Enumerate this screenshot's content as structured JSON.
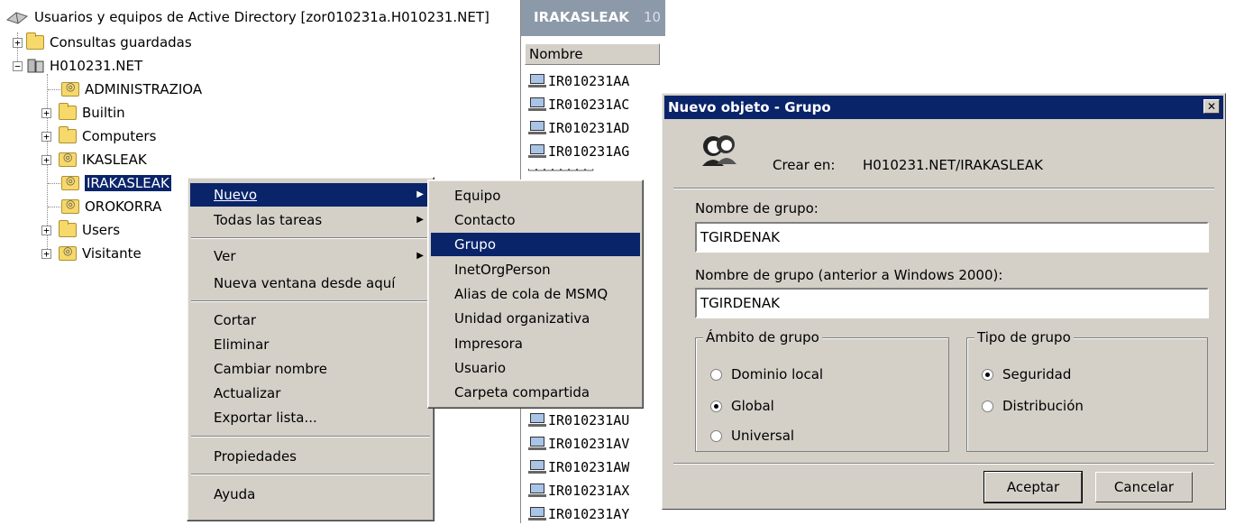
{
  "tree": {
    "root": "Usuarios y equipos de Active Directory [zor010231a.H010231.NET]",
    "items": [
      {
        "label": "Consultas guardadas",
        "type": "folder",
        "expander": "+"
      },
      {
        "label": "H010231.NET",
        "type": "domain",
        "expander": "-"
      },
      {
        "label": "ADMINISTRAZIOA",
        "type": "ou"
      },
      {
        "label": "Builtin",
        "type": "folder",
        "expander": "+"
      },
      {
        "label": "Computers",
        "type": "folder",
        "expander": "+"
      },
      {
        "label": "IKASLEAK",
        "type": "ou",
        "expander": "+"
      },
      {
        "label": "IRAKASLEAK",
        "type": "ou",
        "selected": true
      },
      {
        "label": "OROKORRA",
        "type": "ou"
      },
      {
        "label": "Users",
        "type": "folder",
        "expander": "+"
      },
      {
        "label": "Visitante",
        "type": "ou",
        "expander": "+"
      }
    ]
  },
  "list": {
    "header": "IRAKASLEAK",
    "header_count": "10",
    "column": "Nombre",
    "items_top": [
      "IR010231AA",
      "IR010231AC",
      "IR010231AD",
      "IR010231AG"
    ],
    "items_bottom": [
      "IR010231AU",
      "IR010231AV",
      "IR010231AW",
      "IR010231AX",
      "IR010231AY"
    ]
  },
  "context_menu": {
    "items": [
      "Nuevo",
      "Todas las tareas",
      "Ver",
      "Nueva ventana desde aquí",
      "Cortar",
      "Eliminar",
      "Cambiar nombre",
      "Actualizar",
      "Exportar lista...",
      "Propiedades",
      "Ayuda"
    ]
  },
  "submenu": {
    "items": [
      "Equipo",
      "Contacto",
      "Grupo",
      "InetOrgPerson",
      "Alias de cola de MSMQ",
      "Unidad organizativa",
      "Impresora",
      "Usuario",
      "Carpeta compartida"
    ]
  },
  "dialog": {
    "title": "Nuevo objeto - Grupo",
    "close": "✕",
    "create_in_label": "Crear en:",
    "create_in_value": "H010231.NET/IRAKASLEAK",
    "group_name_label": "Nombre de grupo:",
    "group_name_value": "TGIRDENAK",
    "pre2000_label": "Nombre de grupo (anterior a Windows 2000):",
    "pre2000_value": "TGIRDENAK",
    "scope_title": "Ámbito de grupo",
    "scope_options": [
      "Dominio local",
      "Global",
      "Universal"
    ],
    "scope_selected": "Global",
    "type_title": "Tipo de grupo",
    "type_options": [
      "Seguridad",
      "Distribución"
    ],
    "type_selected": "Seguridad",
    "ok": "Aceptar",
    "cancel": "Cancelar"
  }
}
